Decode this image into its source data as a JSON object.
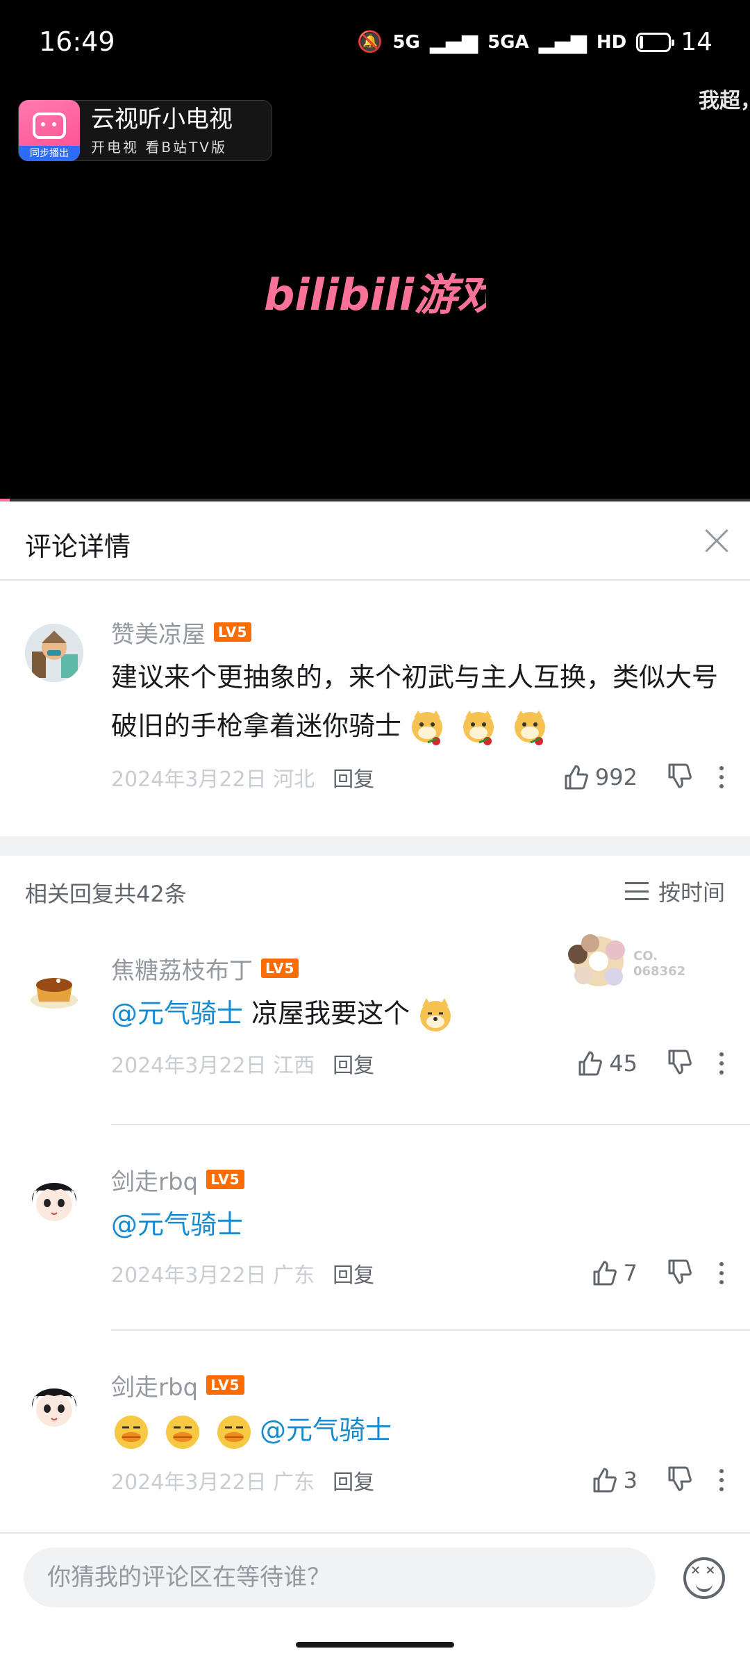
{
  "status_bar": {
    "time": "16:49",
    "network_a": "5G",
    "network_b": "5GA",
    "hd": "HD",
    "battery": "14"
  },
  "video": {
    "danmaku": "我超，",
    "cast": {
      "title": "云视听小电视",
      "subtitle": "开电视 看B站TV版",
      "badge": "同步播出"
    },
    "logo_text": "bilibili游戏",
    "accent_color": "#fb7299"
  },
  "panel": {
    "title": "评论详情"
  },
  "root_comment": {
    "user": "赞美凉屋",
    "level": "LV5",
    "text": "建议来个更抽象的，来个初武与主人互换，类似大号破旧的手枪拿着迷你骑士",
    "emotes": [
      "doge-rose-emote",
      "doge-rose-emote",
      "doge-rose-emote"
    ],
    "date": "2024年3月22日 河北",
    "reply_label": "回复",
    "likes": "992"
  },
  "replies_header": {
    "count_label": "相关回复共42条",
    "sort_label": "按时间"
  },
  "fan_badge": {
    "text_line1": "CO.",
    "text_line2": "068362"
  },
  "replies": [
    {
      "user": "焦糖荔枝布丁",
      "level": "LV5",
      "mention": "@元气骑士",
      "text": "凉屋我要这个",
      "date": "2024年3月22日 江西",
      "reply_label": "回复",
      "likes": "45"
    },
    {
      "user": "剑走rbq",
      "level": "LV5",
      "mention": "@元气骑士",
      "text": "",
      "date": "2024年3月22日 广东",
      "reply_label": "回复",
      "likes": "7"
    },
    {
      "user": "剑走rbq",
      "level": "LV5",
      "mention": "@元气骑士",
      "text": "",
      "date": "2024年3月22日 广东",
      "reply_label": "回复",
      "likes": "3"
    }
  ],
  "input": {
    "placeholder": "你猜我的评论区在等待谁？"
  }
}
